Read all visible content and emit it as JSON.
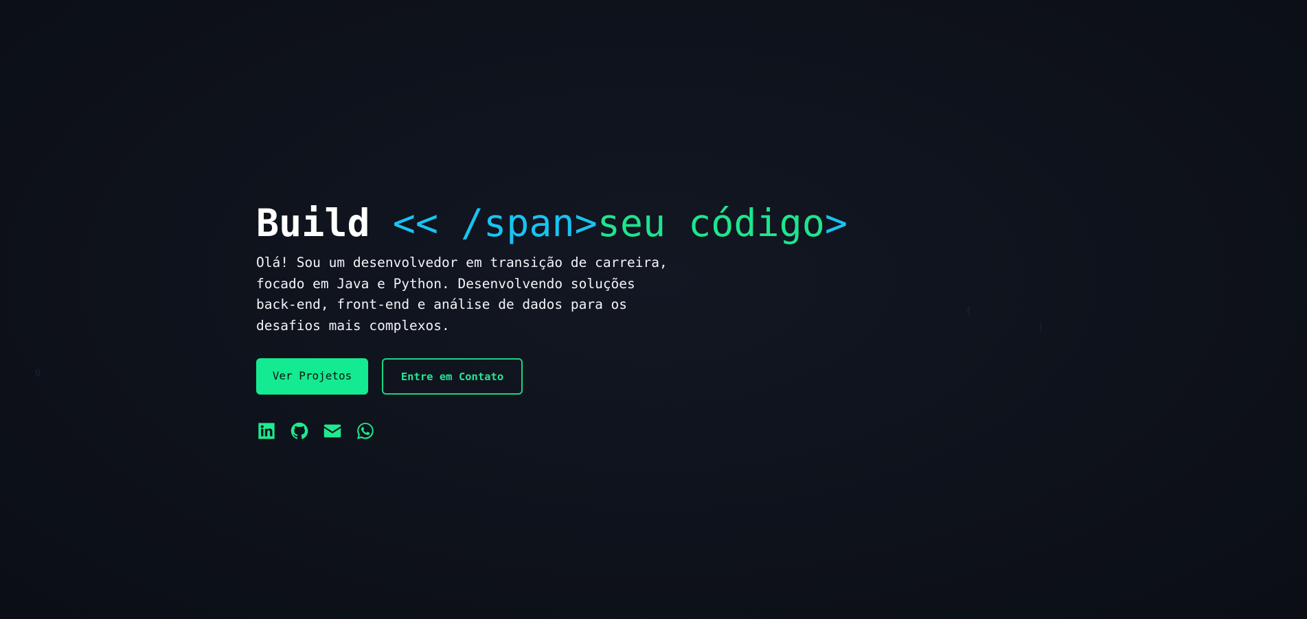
{
  "hero": {
    "headline": {
      "word": "Build",
      "tag_open": "<< /span>",
      "highlight": "seu código",
      "tag_close": ">"
    },
    "intro": "Olá! Sou um desenvolvedor em transição de carreira,\nfocado em Java e Python. Desenvolvendo soluções\nback-end, front-end e análise de dados para os\ndesafios mais complexos.",
    "buttons": {
      "primary": "Ver Projetos",
      "secondary": "Entre em Contato"
    },
    "socials": [
      {
        "icon": "linkedin-icon"
      },
      {
        "icon": "github-icon"
      },
      {
        "icon": "email-icon"
      },
      {
        "icon": "whatsapp-icon"
      }
    ]
  },
  "background": {
    "glyphs": [
      "0",
      "{",
      "}"
    ]
  },
  "colors": {
    "accent_green": "#14ea91",
    "accent_blue": "#19c3f2",
    "background": "#0e121b"
  }
}
